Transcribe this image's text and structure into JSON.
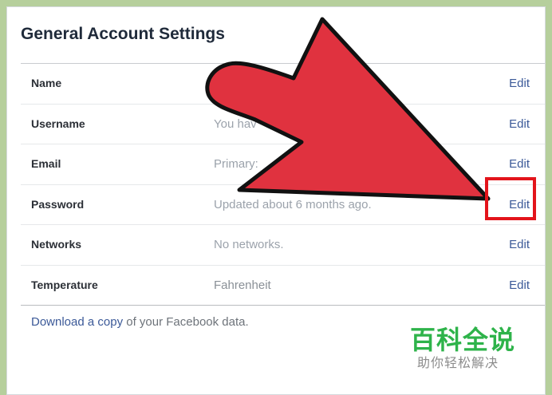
{
  "page": {
    "title": "General Account Settings"
  },
  "rows": [
    {
      "label": "Name",
      "value": "",
      "edit": "Edit"
    },
    {
      "label": "Username",
      "value": "You hav",
      "edit": "Edit"
    },
    {
      "label": "Email",
      "value": "Primary:",
      "edit": "Edit"
    },
    {
      "label": "Password",
      "value": "Updated about 6 months ago.",
      "edit": "Edit"
    },
    {
      "label": "Networks",
      "value": "No networks.",
      "edit": "Edit"
    },
    {
      "label": "Temperature",
      "value": "Fahrenheit",
      "edit": "Edit"
    }
  ],
  "footer": {
    "link": "Download a copy",
    "text": " of your Facebook data."
  },
  "watermark": {
    "title": "百科全说",
    "subtitle": "助你轻松解决"
  },
  "colors": {
    "link": "#3b5998",
    "arrow": "#e0323f",
    "highlight": "#e3141b",
    "background": "#b6cf9c",
    "watermark": "#2eb34a"
  },
  "annotation": {
    "highlighted_row": "Password"
  }
}
